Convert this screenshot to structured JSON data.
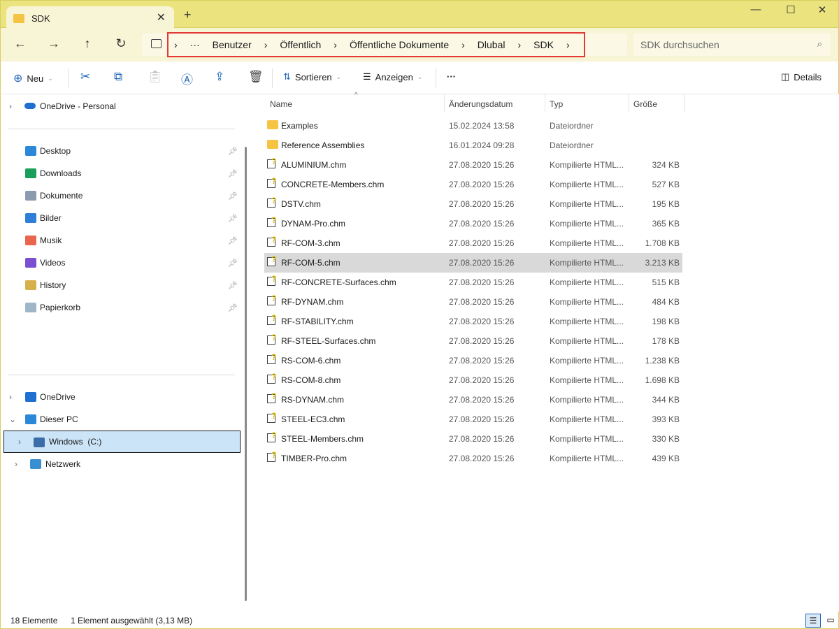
{
  "tab": {
    "title": "SDK",
    "close": "✕",
    "new": "+"
  },
  "window": {
    "minimize": "—",
    "maximize": "☐",
    "close": "✕"
  },
  "nav": {
    "back": "←",
    "forward": "→",
    "up": "↑",
    "refresh": "↻"
  },
  "breadcrumb": {
    "more": "···",
    "items": [
      "Benutzer",
      "Öffentlich",
      "Öffentliche Dokumente",
      "Dlubal",
      "SDK"
    ]
  },
  "search": {
    "placeholder": "SDK durchsuchen"
  },
  "toolbar": {
    "new": "Neu",
    "sort": "Sortieren",
    "view": "Anzeigen",
    "more": "···",
    "details": "Details"
  },
  "sidebar": {
    "top": "OneDrive - Personal",
    "quick": [
      {
        "label": "Desktop",
        "color": "#2b88d8"
      },
      {
        "label": "Downloads",
        "color": "#1a9e5b"
      },
      {
        "label": "Dokumente",
        "color": "#8a9bb0"
      },
      {
        "label": "Bilder",
        "color": "#2f7ed8"
      },
      {
        "label": "Musik",
        "color": "#e8664e"
      },
      {
        "label": "Videos",
        "color": "#7a4fd1"
      },
      {
        "label": "History",
        "color": "#d6b04a"
      },
      {
        "label": "Papierkorb",
        "color": "#9fb6c9"
      }
    ],
    "bottom": [
      {
        "label": "OneDrive",
        "chev": "›"
      },
      {
        "label": "Dieser PC",
        "chev": "⌄"
      },
      {
        "label": "Windows  (C:)",
        "chev": "›"
      },
      {
        "label": "Netzwerk",
        "chev": "›"
      }
    ]
  },
  "columns": {
    "name": "Name",
    "date": "Änderungsdatum",
    "type": "Typ",
    "size": "Größe"
  },
  "files": [
    {
      "name": "Examples",
      "date": "15.02.2024 13:58",
      "type": "Dateiordner",
      "size": "",
      "kind": "folder"
    },
    {
      "name": "Reference Assemblies",
      "date": "16.01.2024 09:28",
      "type": "Dateiordner",
      "size": "",
      "kind": "folder"
    },
    {
      "name": "ALUMINIUM.chm",
      "date": "27.08.2020 15:26",
      "type": "Kompilierte HTML...",
      "size": "324 KB",
      "kind": "chm"
    },
    {
      "name": "CONCRETE-Members.chm",
      "date": "27.08.2020 15:26",
      "type": "Kompilierte HTML...",
      "size": "527 KB",
      "kind": "chm"
    },
    {
      "name": "DSTV.chm",
      "date": "27.08.2020 15:26",
      "type": "Kompilierte HTML...",
      "size": "195 KB",
      "kind": "chm"
    },
    {
      "name": "DYNAM-Pro.chm",
      "date": "27.08.2020 15:26",
      "type": "Kompilierte HTML...",
      "size": "365 KB",
      "kind": "chm"
    },
    {
      "name": "RF-COM-3.chm",
      "date": "27.08.2020 15:26",
      "type": "Kompilierte HTML...",
      "size": "1.708 KB",
      "kind": "chm"
    },
    {
      "name": "RF-COM-5.chm",
      "date": "27.08.2020 15:26",
      "type": "Kompilierte HTML...",
      "size": "3.213 KB",
      "kind": "chm",
      "selected": true
    },
    {
      "name": "RF-CONCRETE-Surfaces.chm",
      "date": "27.08.2020 15:26",
      "type": "Kompilierte HTML...",
      "size": "515 KB",
      "kind": "chm"
    },
    {
      "name": "RF-DYNAM.chm",
      "date": "27.08.2020 15:26",
      "type": "Kompilierte HTML...",
      "size": "484 KB",
      "kind": "chm"
    },
    {
      "name": "RF-STABILITY.chm",
      "date": "27.08.2020 15:26",
      "type": "Kompilierte HTML...",
      "size": "198 KB",
      "kind": "chm"
    },
    {
      "name": "RF-STEEL-Surfaces.chm",
      "date": "27.08.2020 15:26",
      "type": "Kompilierte HTML...",
      "size": "178 KB",
      "kind": "chm"
    },
    {
      "name": "RS-COM-6.chm",
      "date": "27.08.2020 15:26",
      "type": "Kompilierte HTML...",
      "size": "1.238 KB",
      "kind": "chm"
    },
    {
      "name": "RS-COM-8.chm",
      "date": "27.08.2020 15:26",
      "type": "Kompilierte HTML...",
      "size": "1.698 KB",
      "kind": "chm"
    },
    {
      "name": "RS-DYNAM.chm",
      "date": "27.08.2020 15:26",
      "type": "Kompilierte HTML...",
      "size": "344 KB",
      "kind": "chm"
    },
    {
      "name": "STEEL-EC3.chm",
      "date": "27.08.2020 15:26",
      "type": "Kompilierte HTML...",
      "size": "393 KB",
      "kind": "chm"
    },
    {
      "name": "STEEL-Members.chm",
      "date": "27.08.2020 15:26",
      "type": "Kompilierte HTML...",
      "size": "330 KB",
      "kind": "chm"
    },
    {
      "name": "TIMBER-Pro.chm",
      "date": "27.08.2020 15:26",
      "type": "Kompilierte HTML...",
      "size": "439 KB",
      "kind": "chm"
    }
  ],
  "status": {
    "count": "18 Elemente",
    "selection": "1 Element ausgewählt (3,13 MB)"
  }
}
